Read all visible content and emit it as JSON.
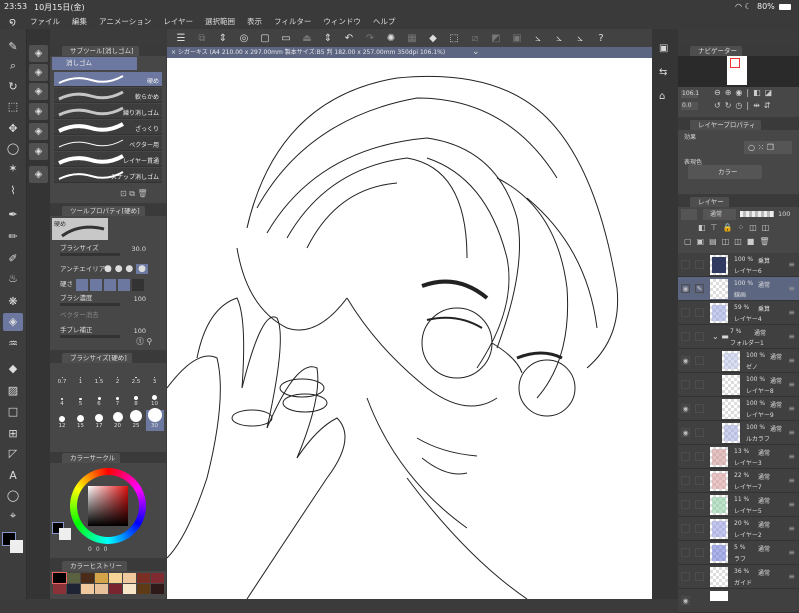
{
  "status": {
    "time": "23:53",
    "date": "10月15日(金)",
    "battery": "80%"
  },
  "menu": [
    "ファイル",
    "編集",
    "アニメーション",
    "レイヤー",
    "選択範囲",
    "表示",
    "フィルター",
    "ウィンドウ",
    "ヘルプ"
  ],
  "document_title": "× シガーキス (A4 210.00 x 297.00mm 製本サイズ:B5 判 182.00 x 257.00mm 350dpi 106.1%)",
  "subtool": {
    "header": "サブツール[消しゴム]",
    "group": "消しゴム",
    "brushes": [
      "硬め",
      "軟らかめ",
      "練り消しゴム",
      "ざっくり",
      "ベクター用",
      "レイヤー貫通",
      "スナップ消しゴム"
    ],
    "selected": 0
  },
  "tool_property": {
    "header": "ツールプロパティ[硬め]",
    "preview_label": "硬め",
    "rows": [
      {
        "label": "ブラシサイズ",
        "value": "30.0"
      },
      {
        "label": "アンチエイリアス",
        "value": ""
      },
      {
        "label": "硬さ",
        "value": ""
      },
      {
        "label": "ブラシ濃度",
        "value": "100"
      },
      {
        "label": "ベクター消去",
        "value": ""
      },
      {
        "label": "手ブレ補正",
        "value": "100"
      }
    ]
  },
  "brush_size": {
    "header": "ブラシサイズ[硬め]",
    "sizes": [
      "0.7",
      "1",
      "1.5",
      "2",
      "2.5",
      "3",
      "4",
      "5",
      "6",
      "7",
      "8",
      "10",
      "12",
      "15",
      "17",
      "20",
      "25",
      "30"
    ],
    "selected": "30"
  },
  "color_circle": {
    "header": "カラーサークル",
    "hue_values": [
      "0",
      "0",
      "0"
    ],
    "main_color": "#000000",
    "sub_color": "#ffffff"
  },
  "color_history": {
    "header": "カラーヒストリー",
    "colors": [
      "#000000",
      "#5a6141",
      "#4a2c18",
      "#d4a548",
      "#f5d496",
      "#f0c99e",
      "#7a2f24",
      "#7e2a30",
      "#8a3238",
      "#1e2433",
      "#f0c9a0",
      "#e8c09a",
      "#7a2430",
      "#f8e6c8",
      "#5e3a16",
      "#2e1a18"
    ]
  },
  "navigator": {
    "header": "ナビゲーター",
    "zoom": "106.1",
    "rotation": "0.0"
  },
  "layer_property": {
    "header": "レイヤープロパティ",
    "effect_label": "効果",
    "expression_label": "表現色",
    "expression_value": "カラー"
  },
  "layer_panel": {
    "header": "レイヤー",
    "blend": "通常",
    "opacity": "100",
    "layers": [
      {
        "pct": "100 %",
        "mode": "乗算",
        "name": "レイヤー6",
        "visible": false,
        "thumb": "#1b2550",
        "indent": 0
      },
      {
        "pct": "100 %",
        "mode": "通常",
        "name": "線画",
        "visible": true,
        "thumb": "",
        "indent": 0,
        "selected": true
      },
      {
        "pct": "59 %",
        "mode": "乗算",
        "name": "レイヤー4",
        "visible": false,
        "thumb": "#8e9be0",
        "indent": 0
      },
      {
        "pct": "7 %",
        "mode": "通常",
        "name": "フォルダー1",
        "visible": false,
        "folder": true,
        "indent": 0
      },
      {
        "pct": "100 %",
        "mode": "通常",
        "name": "ゼノ",
        "visible": true,
        "thumb": "#b8c0e8",
        "indent": 1
      },
      {
        "pct": "100 %",
        "mode": "通常",
        "name": "レイヤー8",
        "visible": false,
        "thumb": "",
        "indent": 1
      },
      {
        "pct": "100 %",
        "mode": "通常",
        "name": "レイヤー9",
        "visible": true,
        "thumb": "",
        "indent": 1
      },
      {
        "pct": "100 %",
        "mode": "通常",
        "name": "ルカラフ",
        "visible": true,
        "thumb": "#9aa4e0",
        "indent": 1
      },
      {
        "pct": "13 %",
        "mode": "通常",
        "name": "レイヤー3",
        "visible": false,
        "thumb": "#d08a8a",
        "indent": 0
      },
      {
        "pct": "22 %",
        "mode": "通常",
        "name": "レイヤー7",
        "visible": false,
        "thumb": "#d89090",
        "indent": 0
      },
      {
        "pct": "11 %",
        "mode": "通常",
        "name": "レイヤー5",
        "visible": false,
        "thumb": "#7ecb9a",
        "indent": 0
      },
      {
        "pct": "20 %",
        "mode": "通常",
        "name": "レイヤー2",
        "visible": false,
        "thumb": "#8a90e0",
        "indent": 0
      },
      {
        "pct": "5 %",
        "mode": "通常",
        "name": "ラフ",
        "visible": false,
        "thumb": "#5a6ad8",
        "indent": 0
      },
      {
        "pct": "36 %",
        "mode": "通常",
        "name": "ガイド",
        "visible": false,
        "thumb": "",
        "indent": 0
      }
    ]
  },
  "colors": {
    "accent": "#6c78a0",
    "panel": "#474747",
    "titlebar": "#5d6681"
  }
}
